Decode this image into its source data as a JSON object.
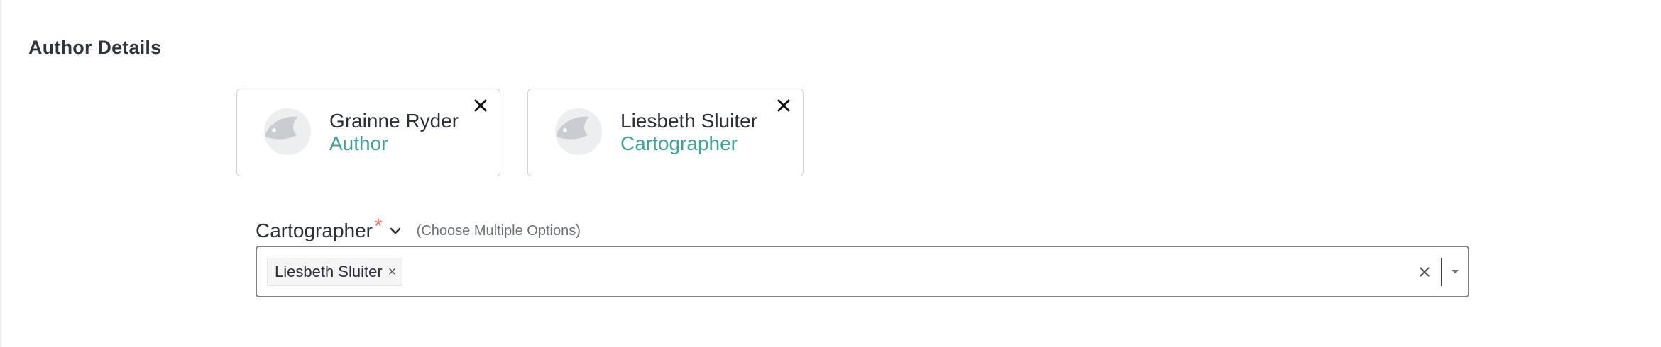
{
  "section": {
    "title": "Author Details"
  },
  "authors": [
    {
      "name": "Grainne Ryder",
      "role": "Author",
      "avatar_icon": "user-avatar-icon",
      "remove_icon": "close-icon"
    },
    {
      "name": "Liesbeth Sluiter",
      "role": "Cartographer",
      "avatar_icon": "user-avatar-icon",
      "remove_icon": "close-icon"
    }
  ],
  "role_field": {
    "label": "Cartographer",
    "required_marker": "*",
    "hint": "(Choose Multiple Options)",
    "chevron_icon": "chevron-down-icon",
    "selected": [
      {
        "label": "Liesbeth Sluiter",
        "remove": "×"
      }
    ],
    "clear_icon": "clear-icon",
    "dropdown_icon": "caret-down-icon"
  },
  "colors": {
    "role_accent": "#3fa39c",
    "required": "#e8765c",
    "text": "#2b2f36"
  }
}
